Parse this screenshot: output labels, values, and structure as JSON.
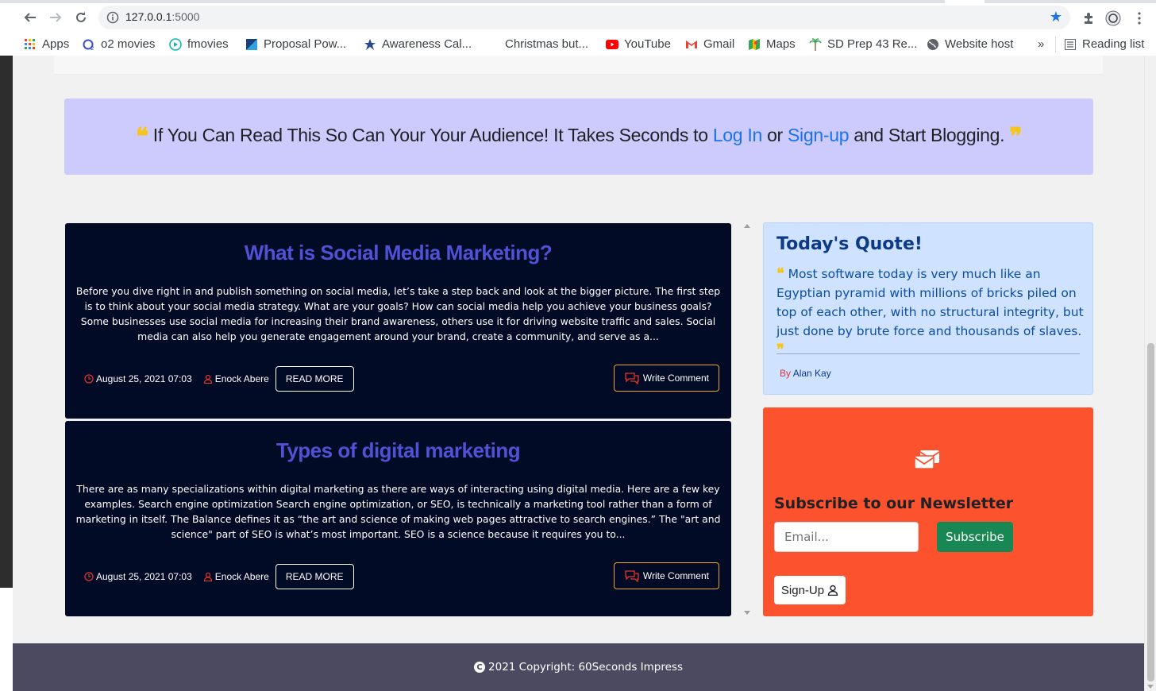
{
  "browser": {
    "url_host": "127.0.0.1",
    "url_port": ":5000",
    "bookmarks": [
      {
        "label": "Apps",
        "icon": "apps-grid-icon"
      },
      {
        "label": "o2 movies",
        "icon": "o2-icon"
      },
      {
        "label": "fmovies",
        "icon": "play-circle-icon"
      },
      {
        "label": "Proposal Pow...",
        "icon": "document-icon"
      },
      {
        "label": "Awareness Cal...",
        "icon": "star-icon"
      },
      {
        "label": "Christmas but...",
        "icon": ""
      },
      {
        "label": "YouTube",
        "icon": "youtube-icon"
      },
      {
        "label": "Gmail",
        "icon": "gmail-icon"
      },
      {
        "label": "Maps",
        "icon": "maps-icon"
      },
      {
        "label": "SD Prep 43 Re...",
        "icon": "palm-icon"
      },
      {
        "label": "Website host",
        "icon": "globe-icon"
      }
    ],
    "more_bookmarks": "»",
    "reading_list": "Reading list"
  },
  "banner": {
    "part1": "If You Can Read This So Can Your Your Audience! It Takes Seconds to",
    "login": "Log In",
    "or": "or",
    "signup": "Sign-up",
    "part2": "and Start Blogging."
  },
  "posts": [
    {
      "title": "What is Social Media Marketing?",
      "excerpt": "Before you dive right in and publish something on social media, let’s take a step back and look at the bigger picture. The first step is to think about your social media strategy. What are your goals? How can social media help you achieve your business goals? Some businesses use social media for increasing their brand awareness, others use it for driving website traffic and sales. Social media can also help you generate engagement around your brand, create a community, and serve as a...",
      "date": "August 25, 2021 07:03",
      "author": "Enock Abere",
      "read_more": "READ MORE",
      "comment": "Write Comment"
    },
    {
      "title": "Types of digital marketing",
      "excerpt": "There are as many specializations within digital marketing as there are ways of interacting using digital media. Here are a few key examples. Search engine optimization Search engine optimization, or SEO, is technically a marketing tool rather than a form of marketing in itself. The Balance defines it as “the art and science of making web pages attractive to search engines.” The \"art and science\" part of SEO is what’s most important. SEO is a science because it requires you to...",
      "date": "August 25, 2021 07:03",
      "author": "Enock Abere",
      "read_more": "READ MORE",
      "comment": "Write Comment"
    }
  ],
  "quote": {
    "title": "Today's Quote!",
    "text": "Most software today is very much like an Egyptian pyramid with millions of bricks piled on top of each other, with no structural integrity, but just done by brute force and thousands of slaves.",
    "by": "By",
    "author": "Alan Kay"
  },
  "newsletter": {
    "title": "Subscribe to our Newsletter",
    "email_placeholder": "Email...",
    "subscribe": "Subscribe",
    "signup": "Sign-Up"
  },
  "footer": {
    "text": "2021 Copyright: 60Seconds Impress"
  },
  "colors": {
    "banner_bg": "#cdcbfd",
    "post_bg": "#020b26",
    "post_title": "#5051d5",
    "quote_bg": "#cfe2ff",
    "newsletter_bg": "#fc532e",
    "subscribe_btn": "#198754",
    "footer_bg": "#4c4a61",
    "accent_quote": "#f6c51b"
  }
}
